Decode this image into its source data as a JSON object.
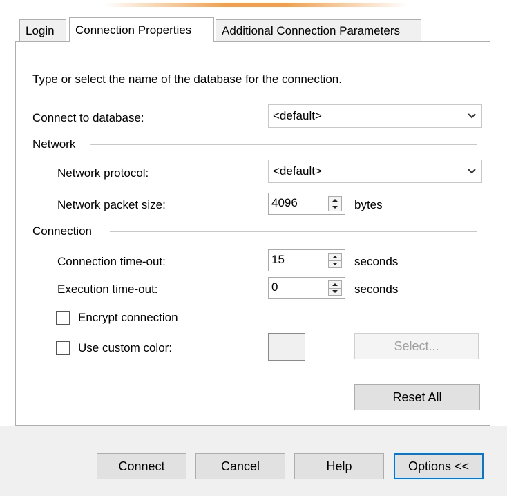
{
  "tabs": [
    {
      "label": "Login"
    },
    {
      "label": "Connection Properties"
    },
    {
      "label": "Additional Connection Parameters"
    }
  ],
  "panel": {
    "instruction": "Type or select the name of the database for the connection.",
    "connect_to_database": {
      "label": "Connect to database:",
      "value": "<default>"
    },
    "network_group": {
      "title": "Network"
    },
    "network_protocol": {
      "label": "Network protocol:",
      "value": "<default>"
    },
    "packet_size": {
      "label": "Network packet size:",
      "value": "4096",
      "unit": "bytes"
    },
    "connection_group": {
      "title": "Connection"
    },
    "connection_timeout": {
      "label": "Connection time-out:",
      "value": "15",
      "unit": "seconds"
    },
    "execution_timeout": {
      "label": "Execution time-out:",
      "value": "0",
      "unit": "seconds"
    },
    "encrypt": {
      "label": "Encrypt connection",
      "checked": false
    },
    "custom_color": {
      "label": "Use custom color:",
      "checked": false
    },
    "select_button": "Select...",
    "reset_button": "Reset All"
  },
  "footer": {
    "connect": "Connect",
    "cancel": "Cancel",
    "help": "Help",
    "options": "Options <<"
  },
  "colors": {
    "accent": "#0078d7",
    "glow": "#f0a050"
  }
}
